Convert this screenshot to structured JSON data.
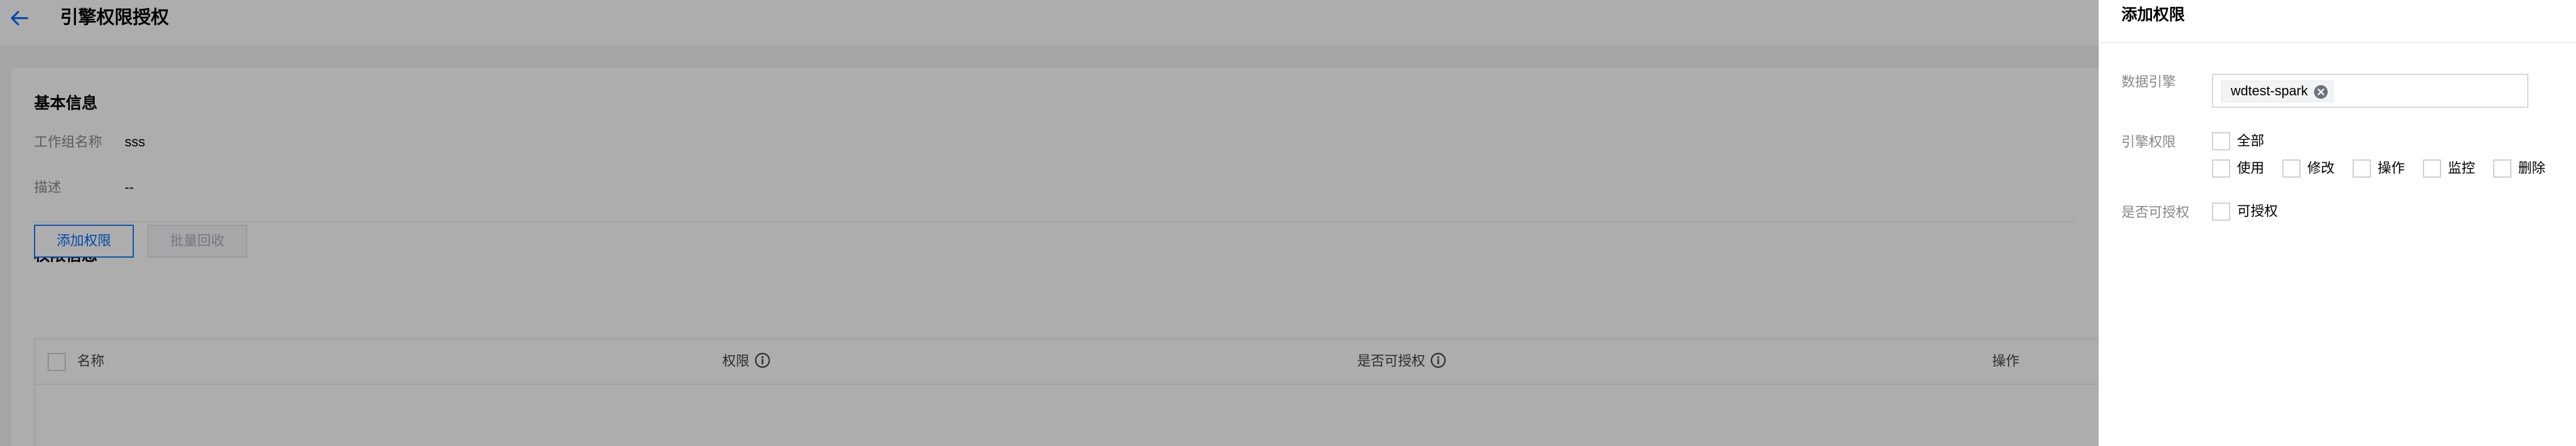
{
  "header": {
    "title": "引擎权限授权",
    "back_icon": "arrow-left-icon"
  },
  "basic_info": {
    "section_title": "基本信息",
    "fields": [
      {
        "label": "工作组名称",
        "value": "sss"
      },
      {
        "label": "描述",
        "value": "--"
      }
    ]
  },
  "permission_info": {
    "section_title": "权限信息",
    "add_button": "添加权限",
    "batch_revoke_button": "批量回收",
    "table": {
      "columns": [
        "名称",
        "权限",
        "是否可授权",
        "操作"
      ],
      "rows": []
    }
  },
  "drawer": {
    "title": "添加权限",
    "engine": {
      "label": "数据引擎",
      "selected_tags": [
        "wdtest-spark"
      ]
    },
    "permission": {
      "label": "引擎权限",
      "all_label": "全部",
      "options": [
        "使用",
        "修改",
        "操作",
        "监控",
        "删除"
      ]
    },
    "grantable": {
      "label": "是否可授权",
      "option": "可授权"
    }
  },
  "colors": {
    "accent": "#006eff",
    "mask": "rgba(0,0,0,0.32)"
  }
}
